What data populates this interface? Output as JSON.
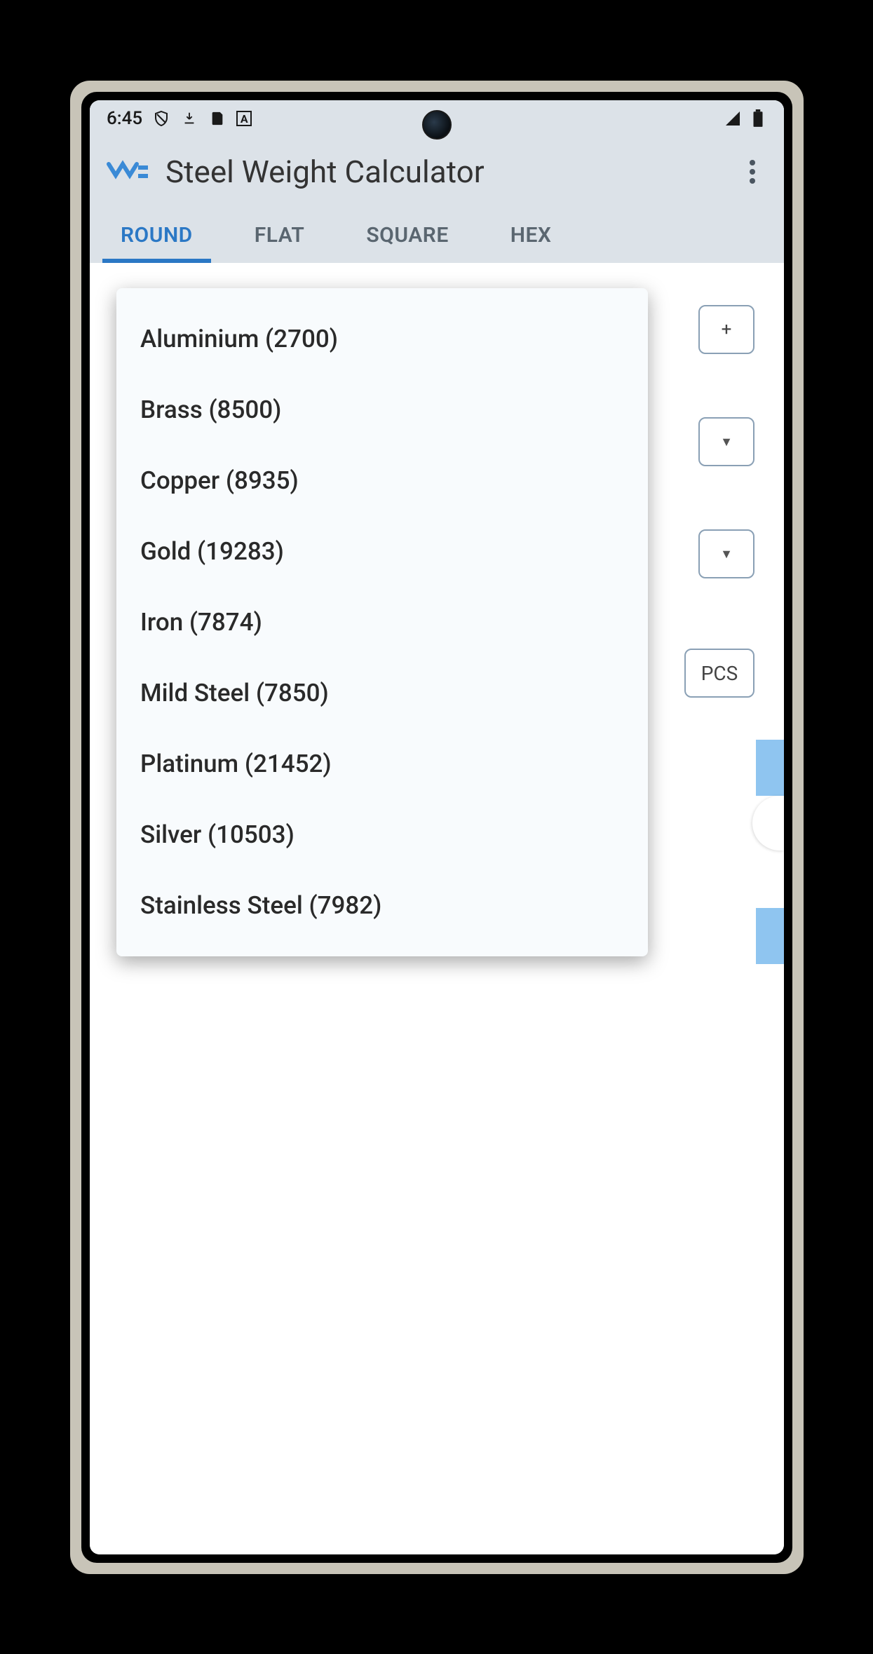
{
  "status": {
    "time": "6:45",
    "icons_left": [
      "shield-icon",
      "download-icon",
      "sd-card-icon",
      "a-box-icon"
    ],
    "icons_right": [
      "signal-icon",
      "battery-icon"
    ]
  },
  "app": {
    "title": "Steel Weight Calculator"
  },
  "tabs": [
    {
      "label": "ROUND",
      "active": true
    },
    {
      "label": "FLAT",
      "active": false
    },
    {
      "label": "SQUARE",
      "active": false
    },
    {
      "label": "HEX",
      "active": false
    }
  ],
  "background_fields": {
    "plus_label": "+",
    "pcs_label": "PCS"
  },
  "dropdown": {
    "items": [
      "Aluminium (2700)",
      "Brass (8500)",
      "Copper (8935)",
      "Gold (19283)",
      "Iron (7874)",
      "Mild Steel (7850)",
      "Platinum (21452)",
      "Silver (10503)",
      "Stainless Steel (7982)"
    ]
  }
}
